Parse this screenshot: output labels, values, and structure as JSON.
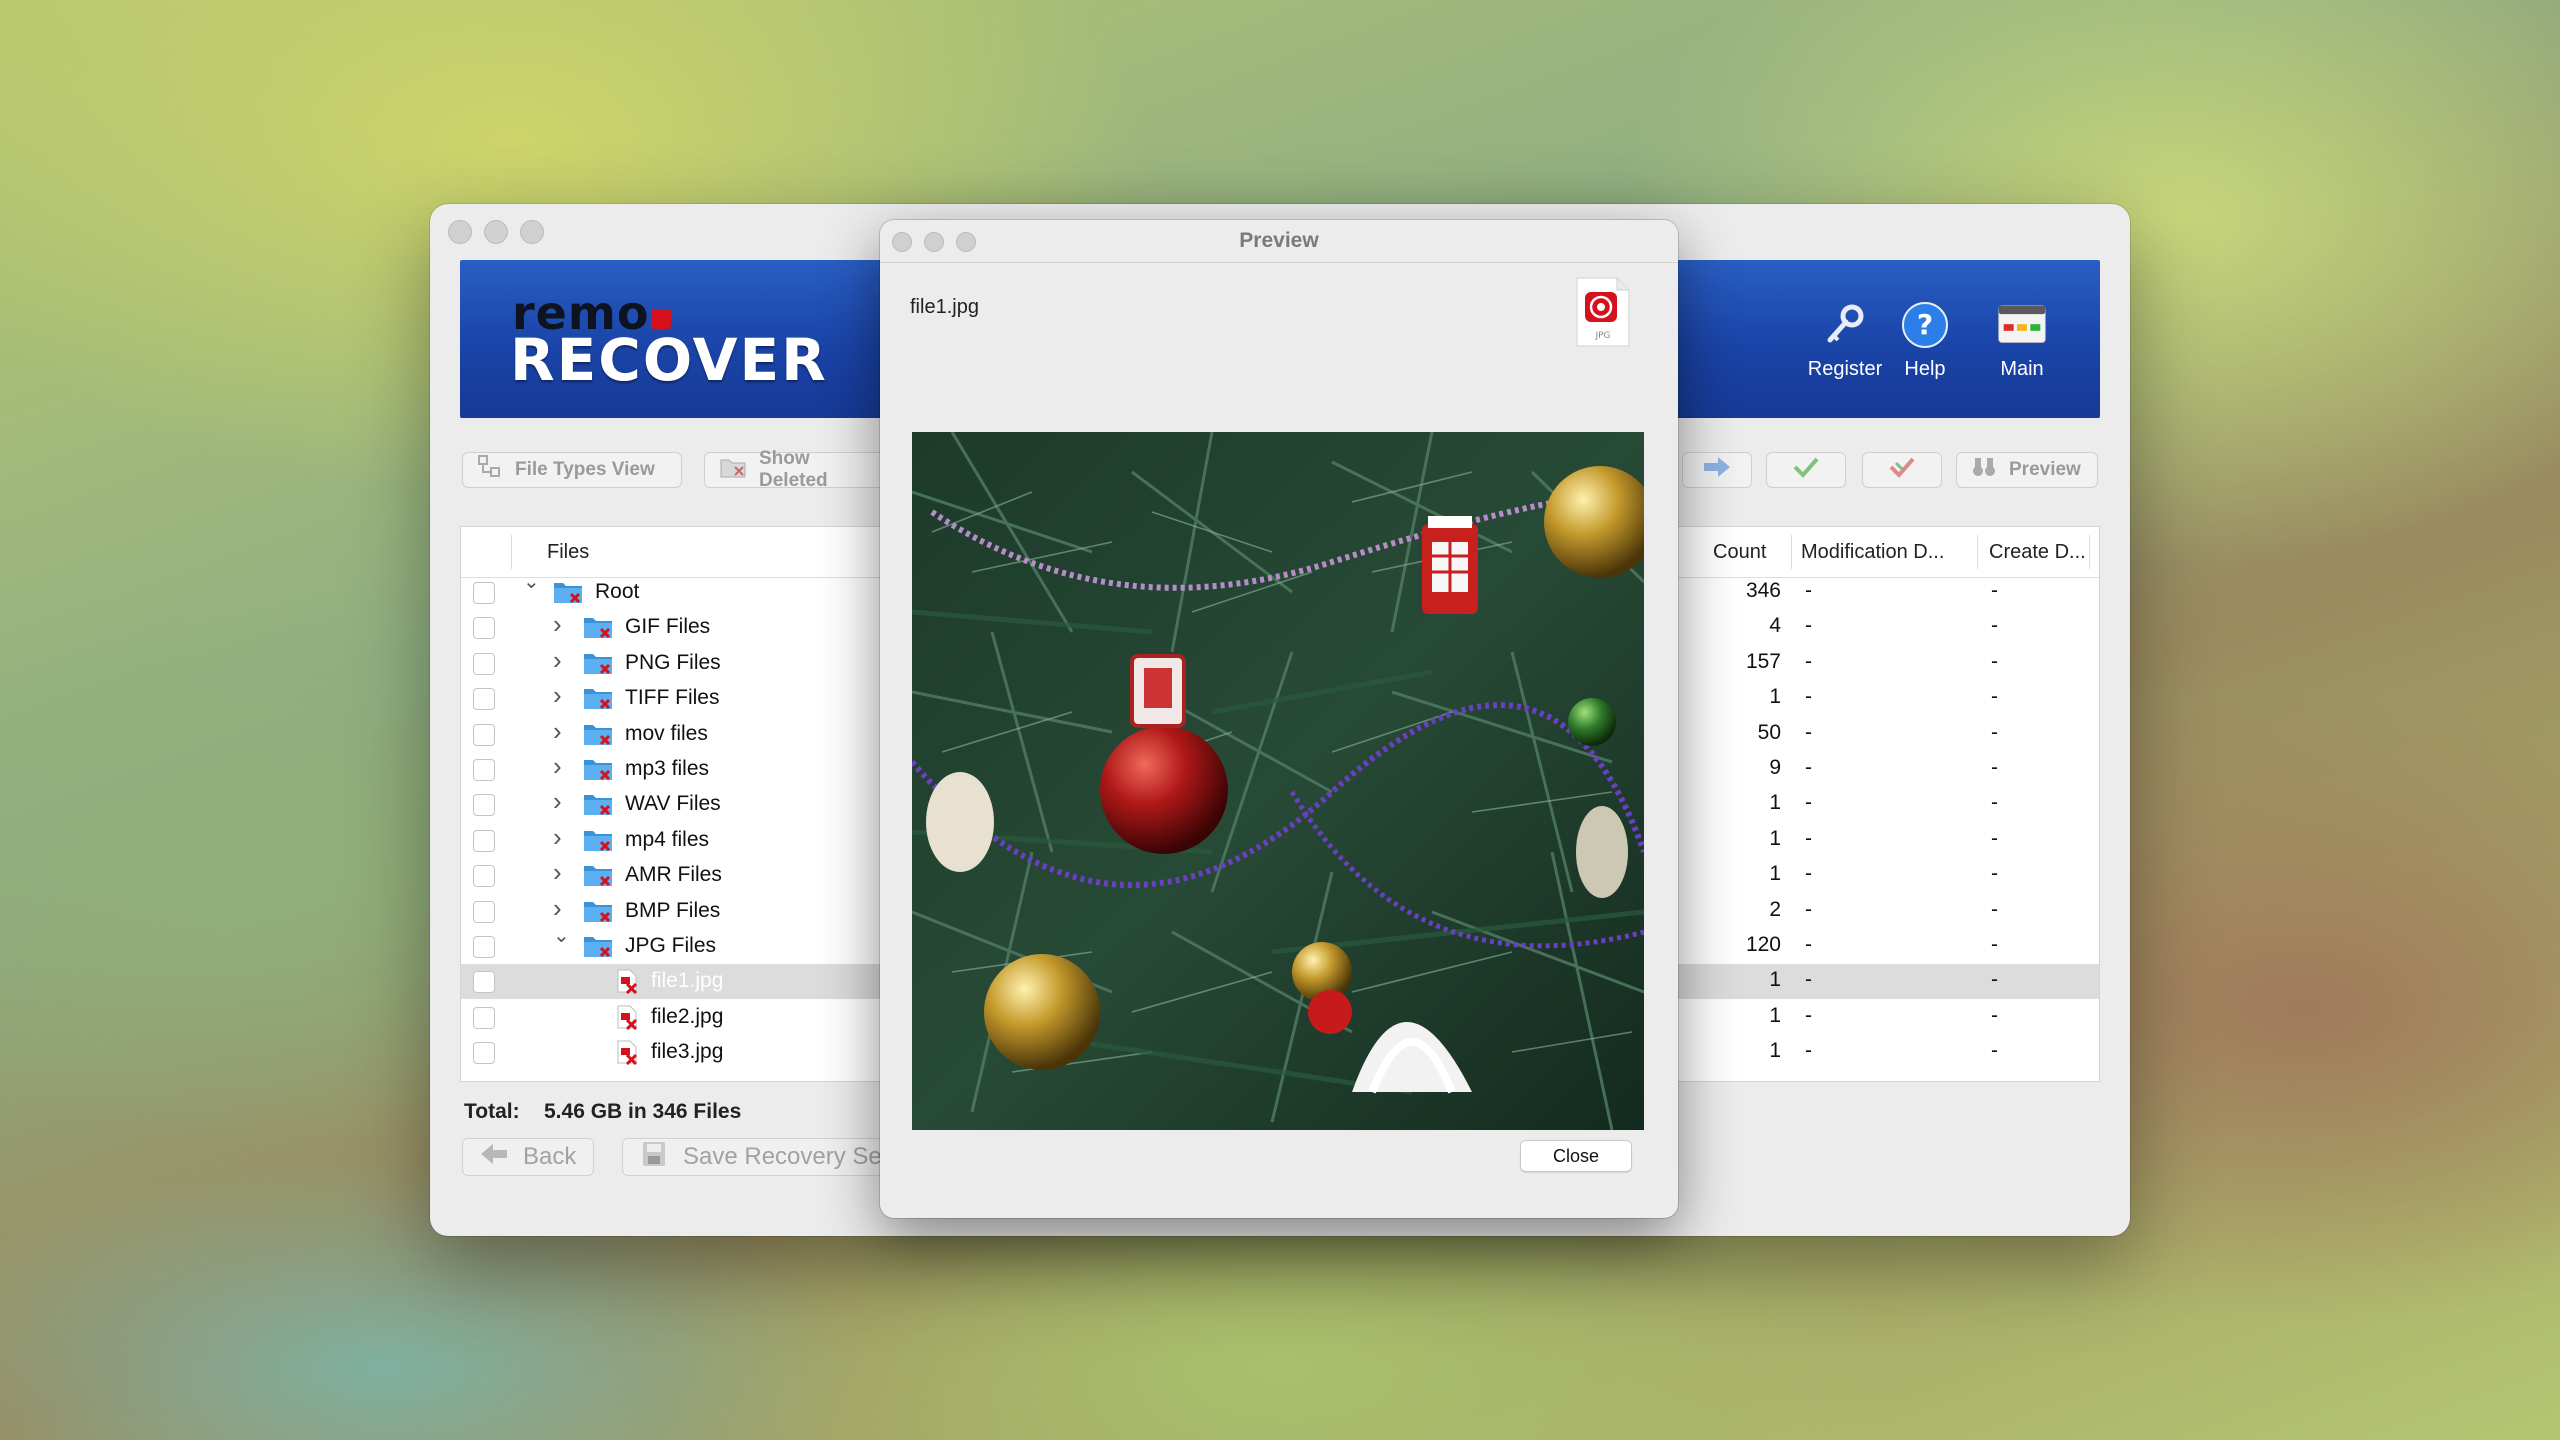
{
  "app": {
    "logo_top": "remo",
    "logo_bottom": "RECOVER"
  },
  "banner_buttons": [
    {
      "label": "Register",
      "icon": "key-icon"
    },
    {
      "label": "Help",
      "icon": "help-icon"
    },
    {
      "label": "Main",
      "icon": "main-icon"
    }
  ],
  "toolbar": {
    "file_types_view": "File Types View",
    "show_deleted": "Show Deleted",
    "preview": "Preview"
  },
  "table": {
    "columns": {
      "files": "Files",
      "count": "Count",
      "modification": "Modification D...",
      "create": "Create D..."
    },
    "rows": [
      {
        "name": "Root",
        "count": "346",
        "mod": "-",
        "create": "-",
        "level": 0,
        "kind": "folder",
        "expanded": true
      },
      {
        "name": "GIF Files",
        "count": "4",
        "mod": "-",
        "create": "-",
        "level": 1,
        "kind": "folder",
        "expanded": false
      },
      {
        "name": "PNG Files",
        "count": "157",
        "mod": "-",
        "create": "-",
        "level": 1,
        "kind": "folder",
        "expanded": false
      },
      {
        "name": "TIFF Files",
        "count": "1",
        "mod": "-",
        "create": "-",
        "level": 1,
        "kind": "folder",
        "expanded": false
      },
      {
        "name": "mov files",
        "count": "50",
        "mod": "-",
        "create": "-",
        "level": 1,
        "kind": "folder",
        "expanded": false
      },
      {
        "name": "mp3 files",
        "count": "9",
        "mod": "-",
        "create": "-",
        "level": 1,
        "kind": "folder",
        "expanded": false
      },
      {
        "name": "WAV Files",
        "count": "1",
        "mod": "-",
        "create": "-",
        "level": 1,
        "kind": "folder",
        "expanded": false
      },
      {
        "name": "mp4 files",
        "count": "1",
        "mod": "-",
        "create": "-",
        "level": 1,
        "kind": "folder",
        "expanded": false
      },
      {
        "name": "AMR Files",
        "count": "1",
        "mod": "-",
        "create": "-",
        "level": 1,
        "kind": "folder",
        "expanded": false
      },
      {
        "name": "BMP Files",
        "count": "2",
        "mod": "-",
        "create": "-",
        "level": 1,
        "kind": "folder",
        "expanded": false
      },
      {
        "name": "JPG Files",
        "count": "120",
        "mod": "-",
        "create": "-",
        "level": 1,
        "kind": "folder",
        "expanded": true
      },
      {
        "name": "file1.jpg",
        "count": "1",
        "mod": "-",
        "create": "-",
        "level": 2,
        "kind": "file",
        "selected": true
      },
      {
        "name": "file2.jpg",
        "count": "1",
        "mod": "-",
        "create": "-",
        "level": 2,
        "kind": "file"
      },
      {
        "name": "file3.jpg",
        "count": "1",
        "mod": "-",
        "create": "-",
        "level": 2,
        "kind": "file"
      }
    ]
  },
  "total": {
    "label": "Total:",
    "value": "5.46 GB in 346 Files"
  },
  "bottom": {
    "back": "Back",
    "save_recovery": "Save Recovery Se"
  },
  "preview": {
    "title": "Preview",
    "filename": "file1.jpg",
    "icon_label": "JPG",
    "close": "Close"
  },
  "colors": {
    "banner": "#1a44a8",
    "selected_row": "#dcdcdc",
    "file_icon_red": "#d6101c"
  }
}
